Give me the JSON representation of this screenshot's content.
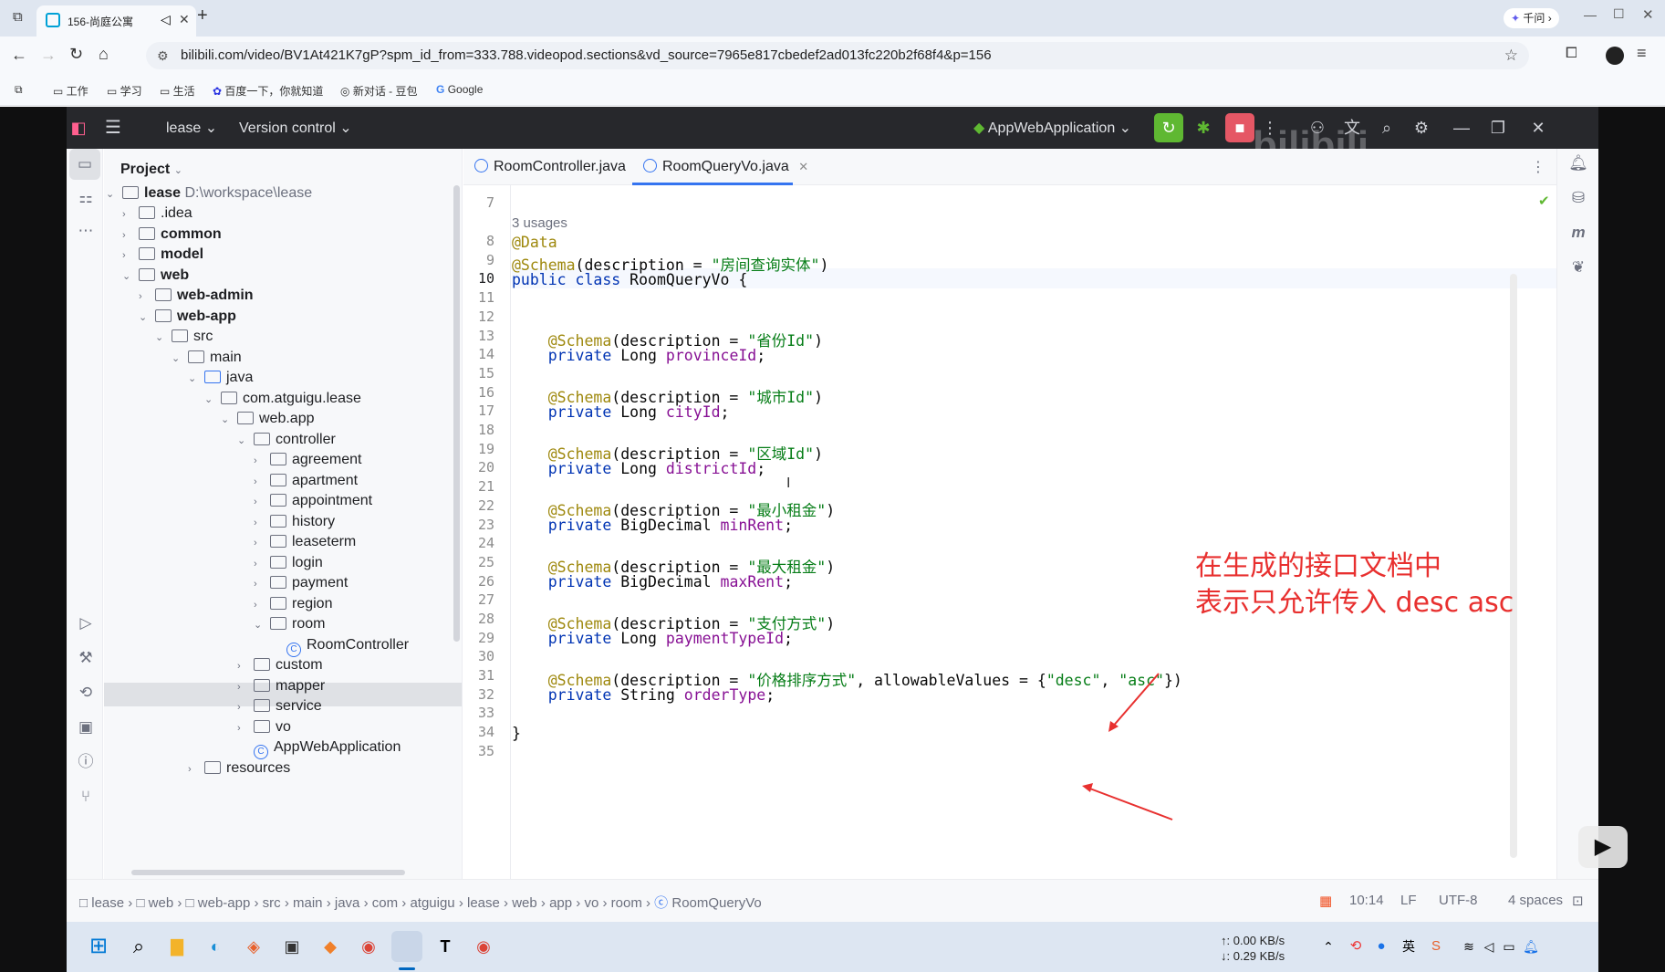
{
  "browser": {
    "tab_title": "156-尚庭公寓",
    "new_tab_symbol": "+",
    "qianwen": "千问",
    "url": "bilibili.com/video/BV1At421K7gP?spm_id_from=333.788.videopod.sections&vd_source=7965e817cbedef2ad013fc220b2f68f4&p=156",
    "bookmarks": [
      "工作",
      "学习",
      "生活",
      "百度一下，你就知道",
      "新对话 - 豆包",
      "Google"
    ]
  },
  "ide": {
    "project_name": "lease",
    "version_control": "Version control",
    "run_config": "AppWebApplication",
    "project_label": "Project",
    "watermark": "bilibili"
  },
  "tree": [
    {
      "label": "lease",
      "extra": "D:\\workspace\\lease"
    },
    {
      "label": ".idea"
    },
    {
      "label": "common"
    },
    {
      "label": "model"
    },
    {
      "label": "web"
    },
    {
      "label": "web-admin"
    },
    {
      "label": "web-app"
    },
    {
      "label": "src"
    },
    {
      "label": "main"
    },
    {
      "label": "java"
    },
    {
      "label": "com.atguigu.lease"
    },
    {
      "label": "web.app"
    },
    {
      "label": "controller"
    },
    {
      "label": "agreement"
    },
    {
      "label": "apartment"
    },
    {
      "label": "appointment"
    },
    {
      "label": "history"
    },
    {
      "label": "leaseterm"
    },
    {
      "label": "login"
    },
    {
      "label": "payment"
    },
    {
      "label": "region"
    },
    {
      "label": "room"
    },
    {
      "label": "RoomController"
    },
    {
      "label": "custom"
    },
    {
      "label": "mapper"
    },
    {
      "label": "service"
    },
    {
      "label": "vo"
    },
    {
      "label": "AppWebApplication"
    },
    {
      "label": "resources"
    }
  ],
  "editor": {
    "tabs": [
      "RoomController.java",
      "RoomQueryVo.java"
    ],
    "usages": "3 usages",
    "line_numbers": [
      "7",
      "8",
      "9",
      "10",
      "11",
      "12",
      "13",
      "14",
      "15",
      "16",
      "17",
      "18",
      "19",
      "20",
      "21",
      "22",
      "23",
      "24",
      "25",
      "26",
      "27",
      "28",
      "29",
      "30",
      "31",
      "32",
      "33",
      "34",
      "35"
    ],
    "code": {
      "data": "@Data",
      "schema": "@Schema",
      "desc_key": "(description = ",
      "class_desc": "\"房间查询实体\"",
      "public": "public",
      "class": "class",
      "classname": " RoomQueryVo {",
      "private": "private",
      "long": " Long ",
      "bigdecimal": " BigDecimal ",
      "string": " String ",
      "f1": "provinceId",
      "d1": "\"省份Id\"",
      "f2": "cityId",
      "d2": "\"城市Id\"",
      "f3": "districtId",
      "d3": "\"区域Id\"",
      "f4": "minRent",
      "d4": "\"最小租金\"",
      "f5": "maxRent",
      "d5": "\"最大租金\"",
      "f6": "paymentTypeId",
      "d6": "\"支付方式\"",
      "f7": "orderType",
      "d7": "\"价格排序方式\"",
      "allow": ", allowableValues = {",
      "v1": "\"desc\"",
      "comma": ", ",
      "v2": "\"asc\"",
      "close_allow": "})",
      "close_paren": ")",
      "semi": ";",
      "close_brace": "}"
    }
  },
  "annotation": {
    "line1": "在生成的接口文档中",
    "line2": "表示只允许传入 desc asc"
  },
  "status": {
    "breadcrumbs": [
      "lease",
      "web",
      "web-app",
      "src",
      "main",
      "java",
      "com",
      "atguigu",
      "lease",
      "web",
      "app",
      "vo",
      "room",
      "RoomQueryVo"
    ],
    "position": "10:14",
    "line_sep": "LF",
    "encoding": "UTF-8",
    "indent": "4 spaces"
  },
  "taskbar": {
    "up": "↑: 0.00 KB/s",
    "down": "↓: 0.29 KB/s"
  }
}
